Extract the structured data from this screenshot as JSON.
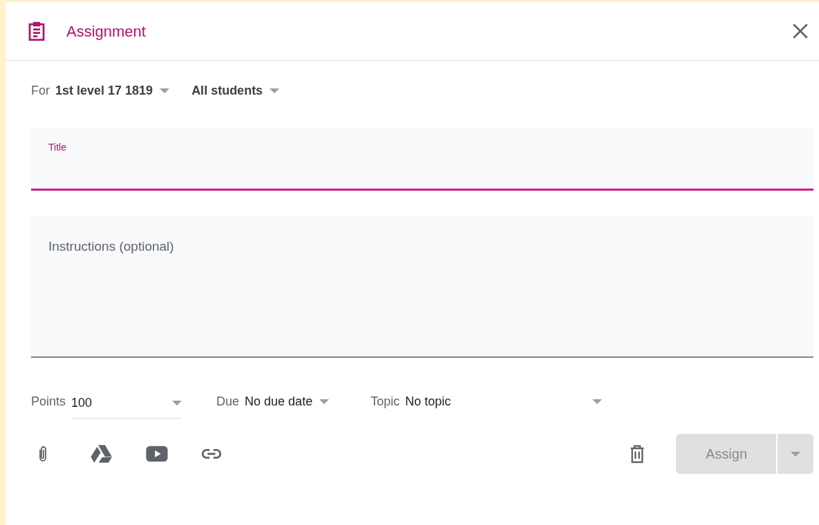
{
  "dialog": {
    "title": "Assignment"
  },
  "for_row": {
    "label": "For",
    "class": "1st level 17 1819",
    "students": "All students"
  },
  "title_field": {
    "label": "Title",
    "focused": true
  },
  "instructions_field": {
    "placeholder": "Instructions (optional)"
  },
  "points": {
    "label": "Points",
    "value": "100"
  },
  "due": {
    "label": "Due",
    "value": "No due date"
  },
  "topic": {
    "label": "Topic",
    "value": "No topic"
  },
  "assign_button": {
    "label": "Assign",
    "disabled": true
  }
}
